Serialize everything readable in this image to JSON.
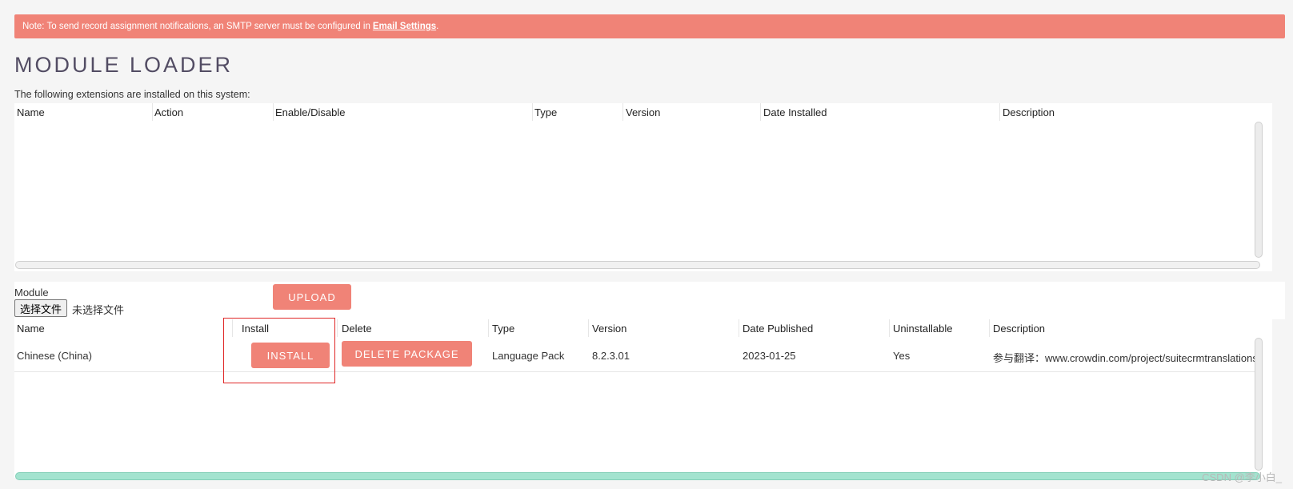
{
  "notice": {
    "text": "Note: To send record assignment notifications, an SMTP server must be configured in",
    "link": "Email Settings",
    "suffix": "."
  },
  "page_title": "MODULE LOADER",
  "installed_section": {
    "subtitle": "The following extensions are installed on this system:",
    "columns": [
      "Name",
      "Action",
      "Enable/Disable",
      "Type",
      "Version",
      "Date Installed",
      "Description"
    ]
  },
  "upload": {
    "module_label": "Module",
    "choose_file_label": "选择文件",
    "no_file_text": "未选择文件",
    "upload_label": "UPLOAD"
  },
  "packages": {
    "columns": [
      "Name",
      "Install",
      "Delete",
      "Type",
      "Version",
      "Date Published",
      "Uninstallable",
      "Description"
    ],
    "rows": [
      {
        "name": "Chinese (China)",
        "install_label": "INSTALL",
        "delete_label": "DELETE PACKAGE",
        "type": "Language Pack",
        "version": "8.2.3.01",
        "date_published": "2023-01-25",
        "uninstallable": "Yes",
        "description": "参与翻译：www.crowdin.com/project/suitecrmtranslations"
      }
    ]
  },
  "watermark": "CSDN @李小白_",
  "colors": {
    "accent": "#f08377",
    "highlight_border": "#e02828",
    "scrollbar_green": "#a3e3cf"
  }
}
